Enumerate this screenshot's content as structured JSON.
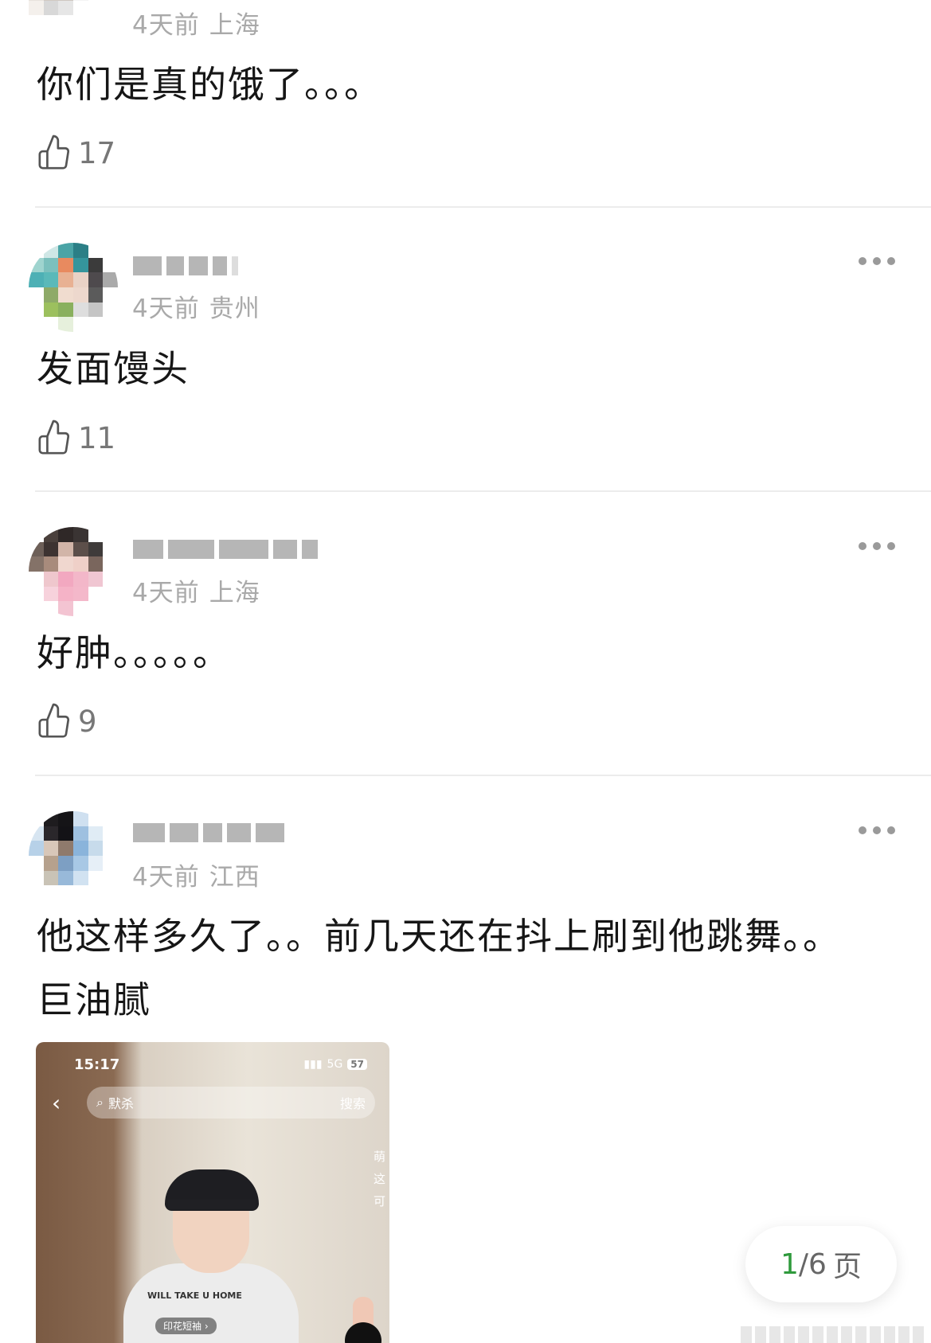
{
  "comments": [
    {
      "meta": {
        "time": "4天前",
        "location": "上海"
      },
      "text": "你们是真的饿了。。。",
      "likes": "17",
      "icons": [
        "thumbs-up-icon"
      ]
    },
    {
      "meta": {
        "time": "4天前",
        "location": "贵州"
      },
      "text": "发面馒头",
      "likes": "11",
      "icons": [
        "thumbs-up-icon",
        "more-options-icon"
      ]
    },
    {
      "meta": {
        "time": "4天前",
        "location": "上海"
      },
      "text": "好肿。。。。。",
      "likes": "9",
      "icons": [
        "thumbs-up-icon",
        "more-options-icon"
      ]
    },
    {
      "meta": {
        "time": "4天前",
        "location": "江西"
      },
      "text_line1": "他这样多久了。。前几天还在抖上刷到他跳舞。。",
      "text_line2": "巨油腻",
      "icons": [
        "more-options-icon"
      ],
      "image": {
        "time": "15:17",
        "network": "5G",
        "battery": "57",
        "search_query": "默杀",
        "search_button": "搜索",
        "side_text": [
          "萌",
          "这",
          "可"
        ],
        "shirt_text": "WILL TAKE U HOME",
        "chip": "印花短袖 ›"
      }
    }
  ],
  "pager": {
    "current": "1",
    "total": "/6",
    "unit": "页"
  },
  "colors": {
    "accent_green": "#2f9a3c",
    "meta_gray": "#a9a9a9",
    "divider": "#ececec"
  }
}
